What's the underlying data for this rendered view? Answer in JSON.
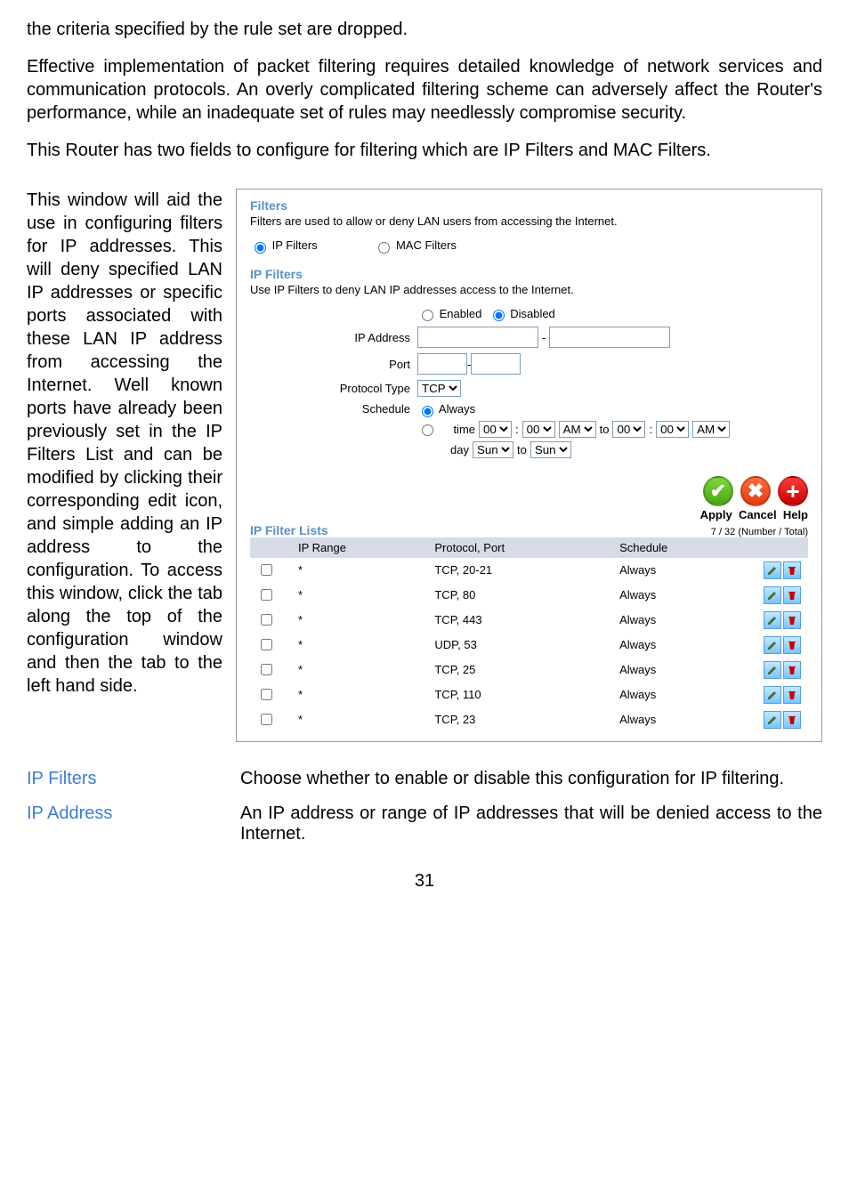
{
  "intro": {
    "p1": "the criteria specified by the rule set are dropped.",
    "p2": "Effective implementation of packet filtering requires detailed knowledge of network services and communication protocols. An overly complicated filtering scheme can adversely affect the Router's performance, while an inadequate set of rules may needlessly compromise security.",
    "p3": "This Router has two fields to configure for filtering which are IP Filters and MAC Filters."
  },
  "leftText": "This window will aid the use in configuring filters for IP addresses. This will deny specified LAN IP addresses or specific ports associated with these LAN IP address from accessing the Internet. Well known ports have already been previously set in the IP Filters List and can be modified by clicking their corresponding edit icon, and simple adding an IP address to the configuration. To access this window, click the tab along the top of the configuration window and then the tab to the left hand side.",
  "panel": {
    "filtersTitle": "Filters",
    "filtersDesc": "Filters are used to allow or deny LAN users from accessing the Internet.",
    "radioIP": "IP Filters",
    "radioMAC": "MAC Filters",
    "ipFiltersTitle": "IP Filters",
    "ipFiltersDesc": "Use IP Filters to deny LAN IP addresses access to the Internet.",
    "enabledLabel": "Enabled",
    "disabledLabel": "Disabled",
    "ipAddressLabel": "IP Address",
    "ipDash": "-",
    "portLabel": "Port",
    "portDash": "-",
    "protocolLabel": "Protocol Type",
    "protocolValue": "TCP",
    "scheduleLabel": "Schedule",
    "alwaysLabel": "Always",
    "timeLabel": "time",
    "colon": ":",
    "toLabel": "to",
    "dayLabel": "day",
    "hour": "00",
    "minute": "00",
    "ampm": "AM",
    "dayVal": "Sun",
    "applyLabel": "Apply",
    "cancelLabel": "Cancel",
    "helpLabel": "Help",
    "listTitle": "IP Filter Lists",
    "listCount": "7 / 32 (Number / Total)",
    "headers": {
      "range": "IP Range",
      "protocol": "Protocol, Port",
      "schedule": "Schedule"
    },
    "rows": [
      {
        "range": "*",
        "protocol": "TCP, 20-21",
        "schedule": "Always"
      },
      {
        "range": "*",
        "protocol": "TCP, 80",
        "schedule": "Always"
      },
      {
        "range": "*",
        "protocol": "TCP, 443",
        "schedule": "Always"
      },
      {
        "range": "*",
        "protocol": "UDP, 53",
        "schedule": "Always"
      },
      {
        "range": "*",
        "protocol": "TCP, 25",
        "schedule": "Always"
      },
      {
        "range": "*",
        "protocol": "TCP, 110",
        "schedule": "Always"
      },
      {
        "range": "*",
        "protocol": "TCP, 23",
        "schedule": "Always"
      }
    ]
  },
  "defs": {
    "term1": "IP Filters",
    "desc1": "Choose whether to enable or disable this configuration for IP filtering.",
    "term2": "IP Address",
    "desc2": "An IP address or range of IP addresses that will be denied access to the Internet."
  },
  "pageNum": "31"
}
